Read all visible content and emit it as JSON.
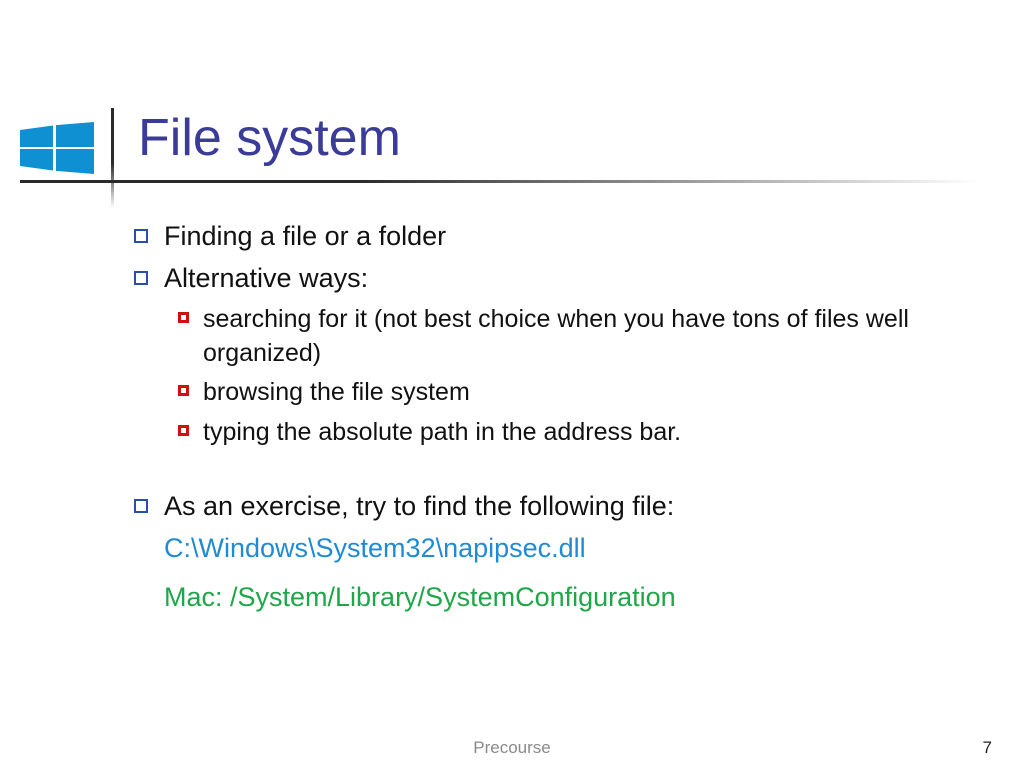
{
  "title": "File system",
  "bullets": {
    "finding": "Finding a file or a folder",
    "alt": "Alternative ways:",
    "search": "searching for it (not best choice when you have tons of files well organized)",
    "browsing": "browsing the file system",
    "typing": "typing the absolute path in the address bar.",
    "exercise": "As an exercise, try to find the following file:"
  },
  "paths": {
    "windows": "C:\\Windows\\System32\\napipsec.dll",
    "mac": "Mac: /System/Library/SystemConfiguration"
  },
  "footer": {
    "center": "Precourse",
    "page": "7"
  },
  "colors": {
    "title": "#3b3b9a",
    "bullet_lvl1": "#2a4db0",
    "bullet_lvl2": "#d01010",
    "path_win": "#1f8bd4",
    "path_mac": "#1fa648"
  }
}
